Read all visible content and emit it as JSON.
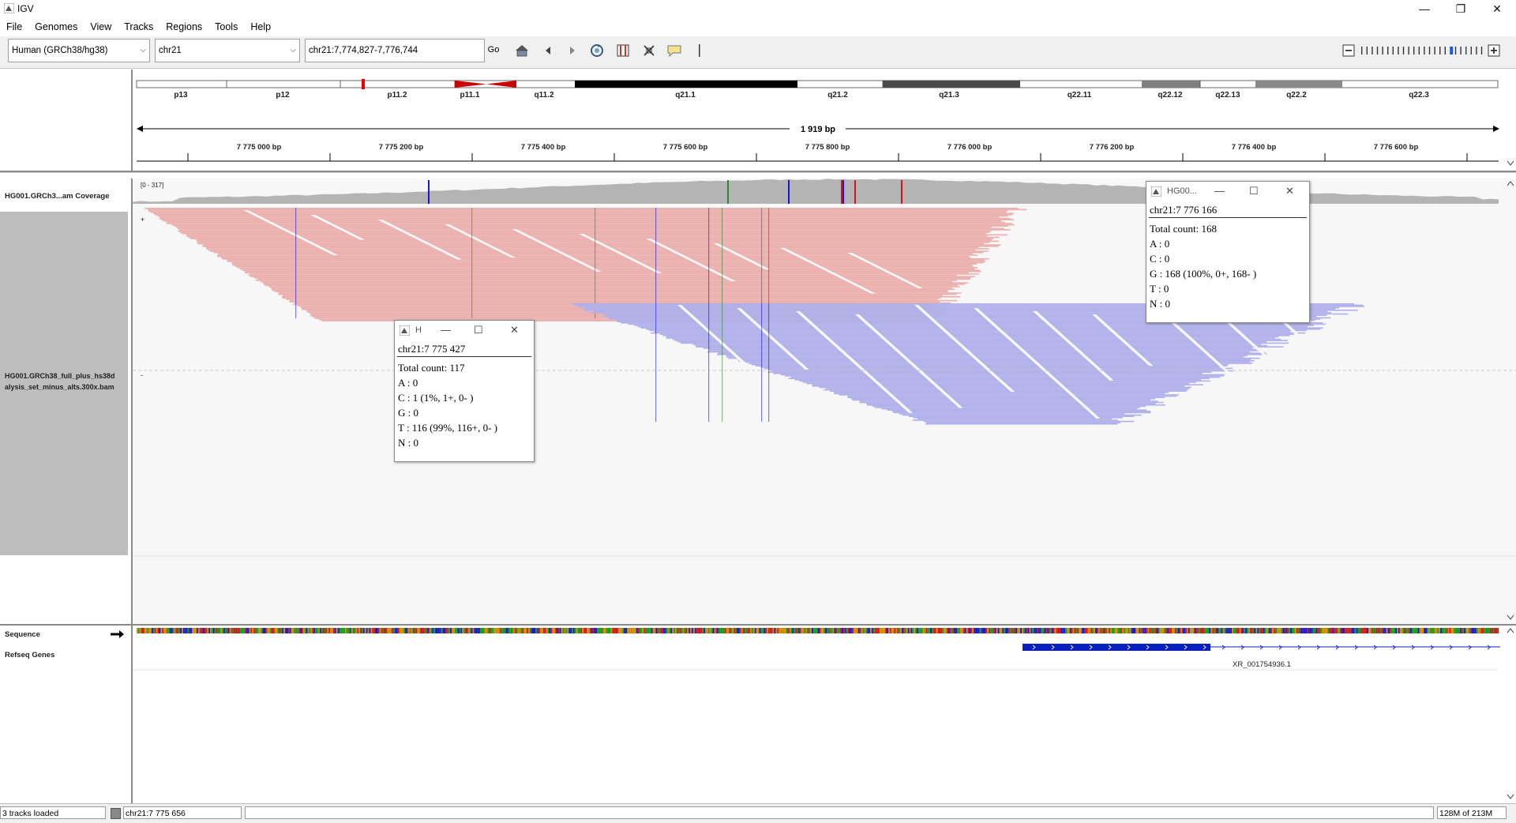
{
  "window": {
    "title": "IGV",
    "controls": [
      "minimize",
      "restore",
      "close"
    ]
  },
  "menu": {
    "items": [
      "File",
      "Genomes",
      "View",
      "Tracks",
      "Regions",
      "Tools",
      "Help"
    ]
  },
  "toolbar": {
    "genome": "Human (GRCh38/hg38)",
    "chromosome": "chr21",
    "locus": "chr21:7,774,827-7,776,744",
    "go_label": "Go",
    "icons": [
      "home-icon",
      "back-icon",
      "forward-icon",
      "refresh-icon",
      "region-icon",
      "fit-icon",
      "popup-info-icon",
      "ruler-icon"
    ],
    "zoom_level_fraction": 0.72
  },
  "ideogram": {
    "bands": [
      "p13",
      "p12",
      "p11.2",
      "p11.1",
      "q11.2",
      "q21.1",
      "q21.2",
      "q21.3",
      "q22.11",
      "q22.12",
      "q22.13",
      "q22.2",
      "q22.3"
    ]
  },
  "ruler": {
    "span_label": "1 919 bp",
    "ticks": [
      "7 775 000 bp",
      "7 775 200 bp",
      "7 775 400 bp",
      "7 775 600 bp",
      "7 775 800 bp",
      "7 776 000 bp",
      "7 776 200 bp",
      "7 776 400 bp",
      "7 776 600 bp"
    ]
  },
  "tracks": {
    "coverage_name": "HG001.GRCh3...am Coverage",
    "coverage_range": "[0 - 317]",
    "alignment_name_line1": "HG001.GRCh38_full_plus_hs38d",
    "alignment_name_line2": "alysis_set_minus_alts.300x.bam",
    "sequence_name": "Sequence",
    "refseq_name": "Refseq Genes",
    "gene_label": "XR_001754936.1",
    "plus_marker": "+",
    "minus_marker": "-"
  },
  "popup_left": {
    "title": "H",
    "lines": [
      "chr21:7 775 427",
      "Total count: 117",
      "A : 0",
      "C : 1 (1%, 1+, 0- )",
      "G : 0",
      "T : 116 (99%, 116+, 0- )",
      "N : 0"
    ]
  },
  "popup_right": {
    "title": "HG00...",
    "lines": [
      "chr21:7 776 166",
      "Total count: 168",
      "A : 0",
      "C : 0",
      "G : 168 (100%, 0+, 168- )",
      "T : 0",
      "N : 0"
    ]
  },
  "statusbar": {
    "tracks_loaded": "3 tracks loaded",
    "position": "chr21:7 775 656",
    "memory": "128M of 213M"
  },
  "colors": {
    "forward_read": "#ebb0ae",
    "reverse_read": "#b0b0ea",
    "coverage": "#b4b4b4",
    "name_panel_selected": "#bdbdbd",
    "gene": "#0a1fbf"
  }
}
